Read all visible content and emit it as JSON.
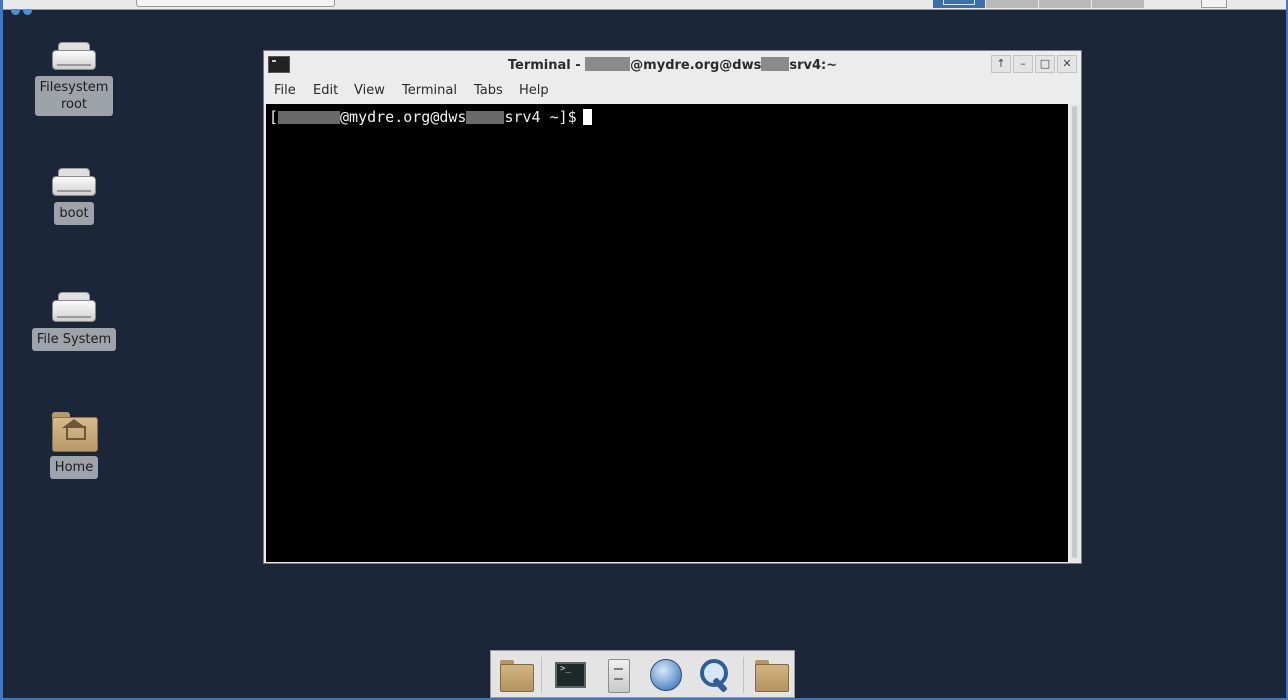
{
  "desktop": {
    "icons": [
      {
        "label": "Filesystem\nroot",
        "line1": "Filesystem",
        "line2": "root"
      },
      {
        "label": "boot"
      },
      {
        "label": "File System"
      },
      {
        "label": "Home"
      }
    ]
  },
  "terminal_window": {
    "title_prefix": "Terminal - ",
    "title_suffix": "@mydre.org@dws",
    "title_tail": "srv4:~",
    "menu": [
      "File",
      "Edit",
      "View",
      "Terminal",
      "Tabs",
      "Help"
    ],
    "prompt_open": "[",
    "prompt_mid": "@mydre.org@dws",
    "prompt_tail": "srv4 ~]$"
  },
  "dock": {
    "items": [
      "file-manager-icon",
      "terminal-icon",
      "file-cabinet-icon",
      "web-browser-icon",
      "search-icon",
      "folder-icon"
    ]
  },
  "colors": {
    "desktop_bg": "#1b2639",
    "workspace_active": "#3d6ea8",
    "terminal_bg": "#000000"
  }
}
